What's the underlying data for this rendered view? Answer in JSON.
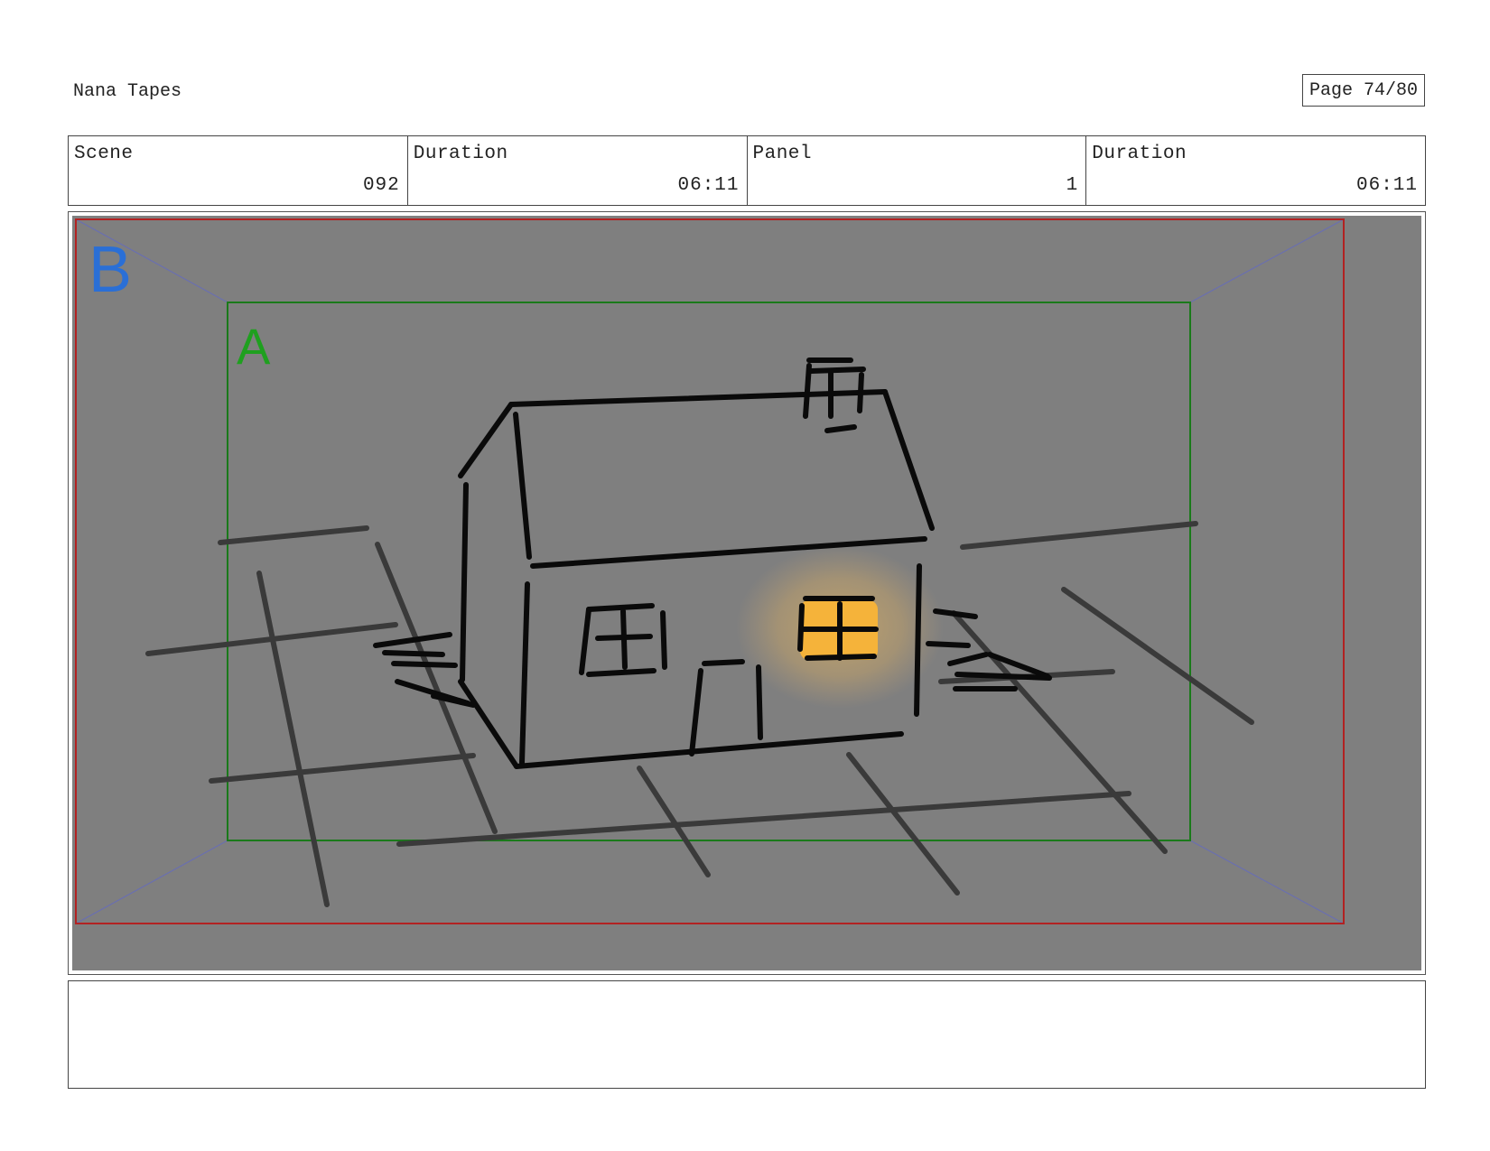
{
  "header": {
    "project_title": "Nana Tapes",
    "page_label": "Page 74/80"
  },
  "info": {
    "scene_label": "Scene",
    "scene_value": "092",
    "scene_duration_label": "Duration",
    "scene_duration_value": "06:11",
    "panel_label": "Panel",
    "panel_value": "1",
    "panel_duration_label": "Duration",
    "panel_duration_value": "06:11"
  },
  "frame": {
    "outer_field_label": "B",
    "inner_field_label": "A",
    "colors": {
      "background": "#7f7f7f",
      "outer_border": "#b22222",
      "inner_border": "#1a7a1a",
      "label_b": "#2a6fd6",
      "label_a": "#1fa01f",
      "window_glow": "#f5b33a"
    },
    "icons": [
      "house-sketch",
      "lit-window-glow"
    ]
  },
  "caption": {
    "text": ""
  }
}
